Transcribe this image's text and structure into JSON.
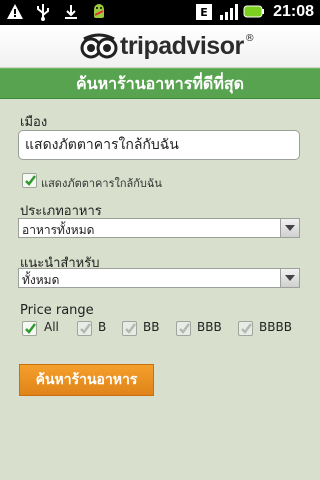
{
  "status_bar": {
    "time": "21:08",
    "icons": [
      "warning-icon",
      "usb-icon",
      "download-icon",
      "android-icon",
      "network-type-icon",
      "signal-icon",
      "battery-icon"
    ]
  },
  "header": {
    "logo_text": "tripadvisor",
    "logo_reg": "®"
  },
  "banner": {
    "title": "ค้นหาร้านอาหารที่ดีที่สุด"
  },
  "form": {
    "city_label": "เมือง",
    "city_value": "แสดงภัตตาคารใกล้กับฉัน",
    "nearby_checkbox_label": "แสดงภัตตาคารใกล้กับฉัน",
    "cuisine_label": "ประเภทอาหาร",
    "cuisine_value": "อาหารทั้งหมด",
    "recommended_label": "แนะนำสำหรับ",
    "recommended_value": "ทั้งหมด",
    "price_label": "Price range",
    "price_options": [
      {
        "label": "All",
        "checked": true
      },
      {
        "label": "B",
        "checked": false
      },
      {
        "label": "BB",
        "checked": false
      },
      {
        "label": "BBB",
        "checked": false
      },
      {
        "label": "BBBB",
        "checked": false
      }
    ],
    "search_button": "ค้นหาร้านอาหาร"
  },
  "colors": {
    "banner": "#58a350",
    "button": "#f0961f",
    "background": "#d8dfcc"
  }
}
